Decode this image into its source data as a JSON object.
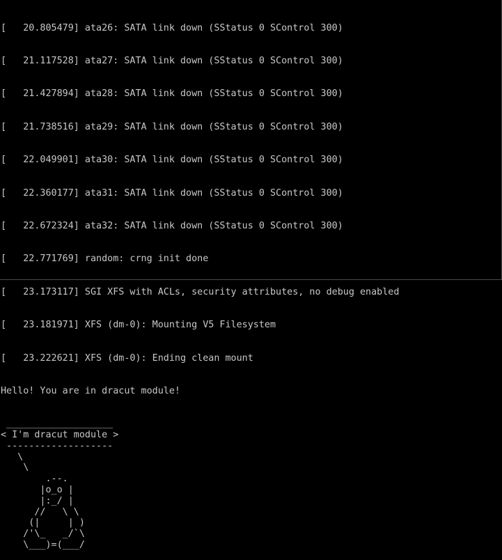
{
  "colors": {
    "background": "#000000",
    "text": "#c8c8c8"
  },
  "console": {
    "lines": [
      "[   20.805479] ata26: SATA link down (SStatus 0 SControl 300)",
      "[   21.117528] ata27: SATA link down (SStatus 0 SControl 300)",
      "[   21.427894] ata28: SATA link down (SStatus 0 SControl 300)",
      "[   21.738516] ata29: SATA link down (SStatus 0 SControl 300)",
      "[   22.049901] ata30: SATA link down (SStatus 0 SControl 300)",
      "[   22.360177] ata31: SATA link down (SStatus 0 SControl 300)",
      "[   22.672324] ata32: SATA link down (SStatus 0 SControl 300)",
      "[   22.771769] random: crng init done",
      "[   23.173117] SGI XFS with ACLs, security attributes, no debug enabled",
      "[   23.181971] XFS (dm-0): Mounting V5 Filesystem",
      "[   23.222621] XFS (dm-0): Ending clean mount",
      "Hello! You are in dracut module!"
    ],
    "cowsay_art": " ___________________\n< I'm dracut module >\n -------------------\n   \\\n    \\\n        .--.\n       |o_o |\n       |:_/ |\n      //   \\ \\\n     (|     | )\n    /'\\_   _/`\\\n    \\___)=(___/"
  }
}
